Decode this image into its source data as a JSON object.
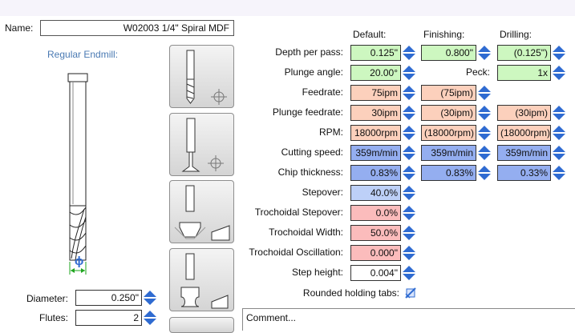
{
  "tool": {
    "name_label": "Name:",
    "name_value": "W02003 1/4\" Spiral MDF",
    "type_title": "Regular Endmill:",
    "diameter_symbol": "ϕ",
    "diameter_label": "Diameter:",
    "diameter_value": "0.250\"",
    "flutes_label": "Flutes:",
    "flutes_value": "2"
  },
  "columns": {
    "default": "Default:",
    "finishing": "Finishing:",
    "drilling": "Drilling:"
  },
  "params": {
    "depth_per_pass": {
      "label": "Depth per pass:",
      "default": "0.125\"",
      "finishing": "0.800\"",
      "drilling": "(0.125\")"
    },
    "plunge_angle": {
      "label": "Plunge angle:",
      "default": "20.00°"
    },
    "peck": {
      "label": "Peck:",
      "drilling": "1x"
    },
    "feedrate": {
      "label": "Feedrate:",
      "default": "75ipm",
      "finishing": "(75ipm)"
    },
    "plunge_feedrate": {
      "label": "Plunge feedrate:",
      "default": "30ipm",
      "finishing": "(30ipm)",
      "drilling": "(30ipm)"
    },
    "rpm": {
      "label": "RPM:",
      "default": "18000rpm",
      "finishing": "(18000rpm)",
      "drilling": "(18000rpm)"
    },
    "cutting_speed": {
      "label": "Cutting speed:",
      "default": "359m/min",
      "finishing": "359m/min",
      "drilling": "359m/min"
    },
    "chip_thickness": {
      "label": "Chip thickness:",
      "default": "0.83%",
      "finishing": "0.83%",
      "drilling": "0.33%"
    },
    "stepover": {
      "label": "Stepover:",
      "default": "40.0%"
    },
    "trochoidal_stepover": {
      "label": "Trochoidal Stepover:",
      "default": "0.0%"
    },
    "trochoidal_width": {
      "label": "Trochoidal Width:",
      "default": "50.0%"
    },
    "trochoidal_oscillation": {
      "label": "Trochoidal Oscillation:",
      "default": "0.000\""
    },
    "step_height": {
      "label": "Step height:",
      "default": "0.004\""
    }
  },
  "rounded_tabs_label": "Rounded holding tabs:",
  "comment_text": "Comment...",
  "colors": {
    "green": "#cdf7c0",
    "orange": "#fcd0bc",
    "blue": "#94aef0",
    "light_blue": "#bdd0f8",
    "pink": "#fbbcbc",
    "spinner": "#2f6bd1"
  },
  "icons": [
    "spinner-arrows-icon",
    "endmill-drill-icon",
    "v-bit-icon",
    "chamfer-bit-icon",
    "roundover-bit-icon",
    "crosshair-icon",
    "rounded-tabs-icon"
  ]
}
